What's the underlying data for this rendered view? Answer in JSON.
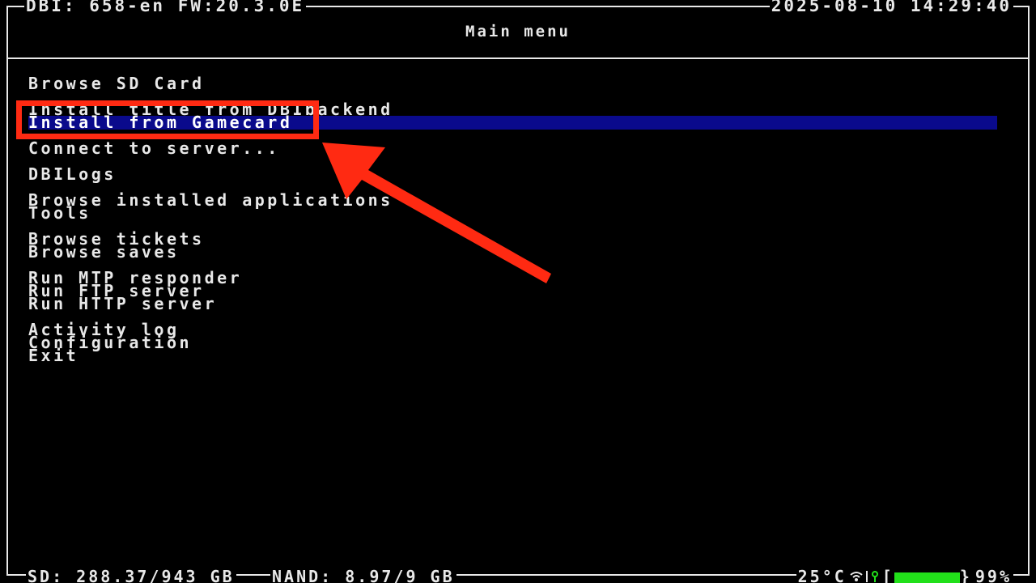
{
  "header": {
    "left": "DBI: 658-en FW:20.3.0E",
    "right": "2025-08-10 14:29:40"
  },
  "title": "Main menu",
  "menu": {
    "items": [
      "Browse SD Card",
      "Install title from DBIbackend",
      "Install from Gamecard",
      "Connect to server...",
      "DBILogs",
      "Browse installed applications",
      "Tools",
      "Browse tickets",
      "Browse saves",
      "Run MTP responder",
      "Run FTP server",
      "Run HTTP server",
      "Activity log",
      "Configuration",
      "Exit"
    ],
    "selected_index": 2
  },
  "footer": {
    "sd": "SD: 288.37/943 GB",
    "nand": "NAND: 8.97/9 GB",
    "temperature": "25°C",
    "battery": "99%",
    "battery_level": 0.99
  },
  "colors": {
    "selection": "#0a0a8c",
    "annotation": "#ff2a12",
    "battery": "#22e01a"
  },
  "icons": [
    "wifi-icon",
    "charging-icon",
    "battery-icon"
  ]
}
